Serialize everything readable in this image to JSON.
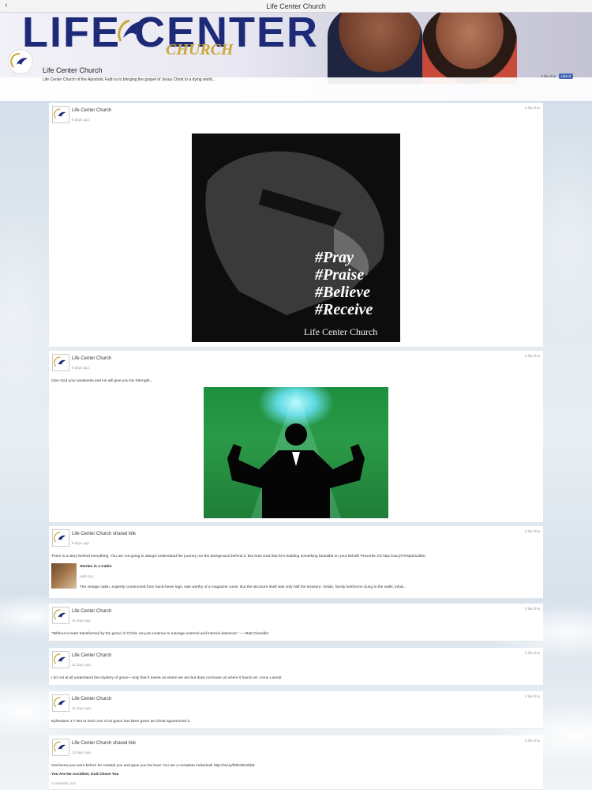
{
  "window": {
    "title": "Life Center Church",
    "back_icon": "chevron-left-icon"
  },
  "header": {
    "cover_word": "LIFE CENTER",
    "cover_sub": "CHURCH",
    "page_name": "Life Center Church",
    "description": "Life Center Church of the Apostolic Faith is to bringing the gospel of Jesus Christ to a dying world...",
    "likes": "0 like this",
    "like_button": "Like 0"
  },
  "posts": [
    {
      "author": "Life Center Church",
      "time": "6 days ago",
      "likes": "0 like this",
      "image": {
        "hashtags": [
          "#Pray",
          "#Praise",
          "#Believe",
          "#Receive"
        ],
        "brand": "Life Center Church"
      }
    },
    {
      "author": "Life Center Church",
      "time": "9 days ago",
      "likes": "0 like this",
      "text": "Give God your weakness and He will give you his Strength..."
    },
    {
      "author": "Life Center Church shared link",
      "time": "9 days ago",
      "likes": "0 like this",
      "text": "There is a story behind everything. You are not going to always understand the journey nor the background behind it. But trust God that he's building something beautiful on your behalf! Proverbs 3:5 http://ow.ly/TKMj3011bb0",
      "link": {
        "title": "Stories in a Cabin",
        "domain": "polli.org",
        "summary": "The vintage cabin, expertly constructed from hand-hewn logs, was worthy of a magazine cover. But the structure itself was only half the treasure. Inside, family heirlooms clung to the walls, infusi..."
      }
    },
    {
      "author": "Life Center Church",
      "time": "11 days ago",
      "likes": "0 like this",
      "text": "\"Without a heart transformed by the grace of Christ, we just continue to manage external and internal darkness.\" — Matt Chandler"
    },
    {
      "author": "Life Center Church",
      "time": "11 days ago",
      "likes": "0 like this",
      "text": "I do not at all understand the mystery of grace—only that it meets us where we are but does not leave us where it found us! -Anne Lamott"
    },
    {
      "author": "Life Center Church",
      "time": "11 days ago",
      "likes": "0 like this",
      "text": "Ephesians 4:7 But to each one of us grace has been given as Christ apportioned it."
    },
    {
      "author": "Life Center Church shared link",
      "time": "13 days ago",
      "likes": "0 like this",
      "text": "God knew you were before he created you and gave you his love! You are a complete individual! http://ow.ly/l6hh3011bbE",
      "link": {
        "title": "You Are No Accident; God Chose You",
        "domain": "crosswalk.com"
      }
    }
  ],
  "colors": {
    "brand_navy": "#1d2a78",
    "brand_gold": "#c9a93b",
    "facebook_blue": "#4267b2"
  }
}
